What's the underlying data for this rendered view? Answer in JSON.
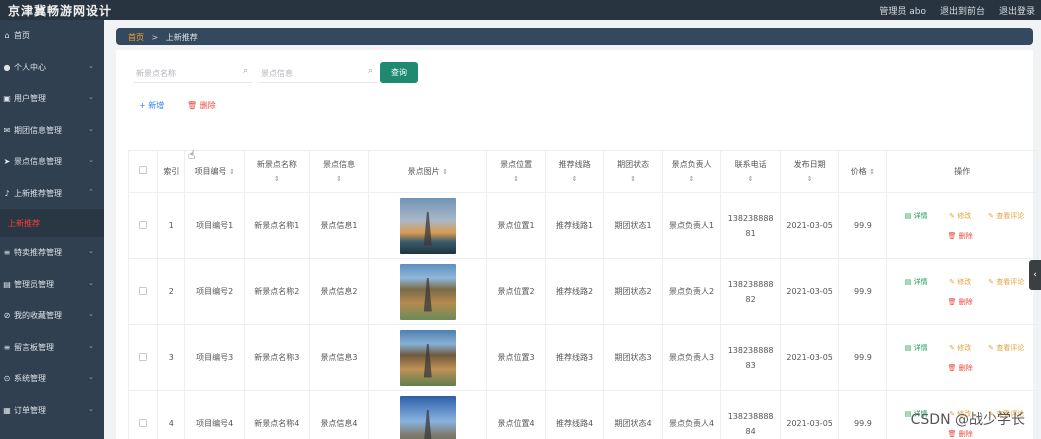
{
  "header": {
    "brand": "京津冀畅游网设计",
    "admin": "管理员 abo",
    "back_front": "退出到前台",
    "logout": "退出登录"
  },
  "sidebar": {
    "items": [
      {
        "label": "首页",
        "icon": "home-icon",
        "glyph": "⌂"
      },
      {
        "label": "个人中心",
        "icon": "user-icon",
        "glyph": "●"
      },
      {
        "label": "用户管理",
        "icon": "users-icon",
        "glyph": "▣"
      },
      {
        "label": "期团信息管理",
        "icon": "mail-icon",
        "glyph": "✉"
      },
      {
        "label": "景点信息管理",
        "icon": "send-icon",
        "glyph": "➤"
      },
      {
        "label": "上新推荐管理",
        "icon": "mic-icon",
        "glyph": "♪"
      },
      {
        "label": "特卖推荐管理",
        "icon": "list-icon",
        "glyph": "≡"
      },
      {
        "label": "管理员管理",
        "icon": "monitor-icon",
        "glyph": "▤"
      },
      {
        "label": "我的收藏管理",
        "icon": "star-icon",
        "glyph": "⊘"
      },
      {
        "label": "留言板管理",
        "icon": "message-icon",
        "glyph": "≡"
      },
      {
        "label": "系统管理",
        "icon": "settings-icon",
        "glyph": "⊙"
      },
      {
        "label": "订单管理",
        "icon": "order-icon",
        "glyph": "▦"
      }
    ],
    "active_sub": "上新推荐"
  },
  "breadcrumb": {
    "home": "首页",
    "separator": ">",
    "current": "上新推荐"
  },
  "search": {
    "name_placeholder": "新景点名称",
    "info_placeholder": "景点信息",
    "query_label": "查询"
  },
  "actions": {
    "add_label": "+ 新增",
    "delete_label": "删除"
  },
  "table": {
    "headers": {
      "index": "索引",
      "code": "项目编号",
      "name": "新景点名称",
      "info": "景点信息",
      "image": "景点图片",
      "location": "景点位置",
      "route": "推荐线路",
      "status": "期团状态",
      "owner": "景点负责人",
      "phone": "联系电话",
      "date": "发布日期",
      "price": "价格",
      "ops": "操作"
    },
    "rows": [
      {
        "index": "1",
        "code": "项目编号1",
        "name": "新景点名称1",
        "info": "景点信息1",
        "location": "景点位置1",
        "route": "推荐线路1",
        "status": "期团状态1",
        "owner": "景点负责人1",
        "phone1": "138238888",
        "phone2": "81",
        "date": "2021-03-05",
        "price": "99.9"
      },
      {
        "index": "2",
        "code": "项目编号2",
        "name": "新景点名称2",
        "info": "景点信息2",
        "location": "景点位置2",
        "route": "推荐线路2",
        "status": "期团状态2",
        "owner": "景点负责人2",
        "phone1": "138238888",
        "phone2": "82",
        "date": "2021-03-05",
        "price": "99.9"
      },
      {
        "index": "3",
        "code": "项目编号3",
        "name": "新景点名称3",
        "info": "景点信息3",
        "location": "景点位置3",
        "route": "推荐线路3",
        "status": "期团状态3",
        "owner": "景点负责人3",
        "phone1": "138238888",
        "phone2": "83",
        "date": "2021-03-05",
        "price": "99.9"
      },
      {
        "index": "4",
        "code": "项目编号4",
        "name": "新景点名称4",
        "info": "景点信息4",
        "location": "景点位置4",
        "route": "推荐线路4",
        "status": "期团状态4",
        "owner": "景点负责人4",
        "phone1": "138238888",
        "phone2": "84",
        "date": "2021-03-05",
        "price": "99.9"
      }
    ],
    "op_labels": {
      "detail": "详情",
      "edit": "修改",
      "review": "查看评论",
      "delete": "删除"
    }
  },
  "watermark": "CSDN @战少学长",
  "colors": {
    "sidebar": "#304050",
    "header": "#283540",
    "accent": "#1f8a70",
    "danger": "#e74c3c"
  }
}
